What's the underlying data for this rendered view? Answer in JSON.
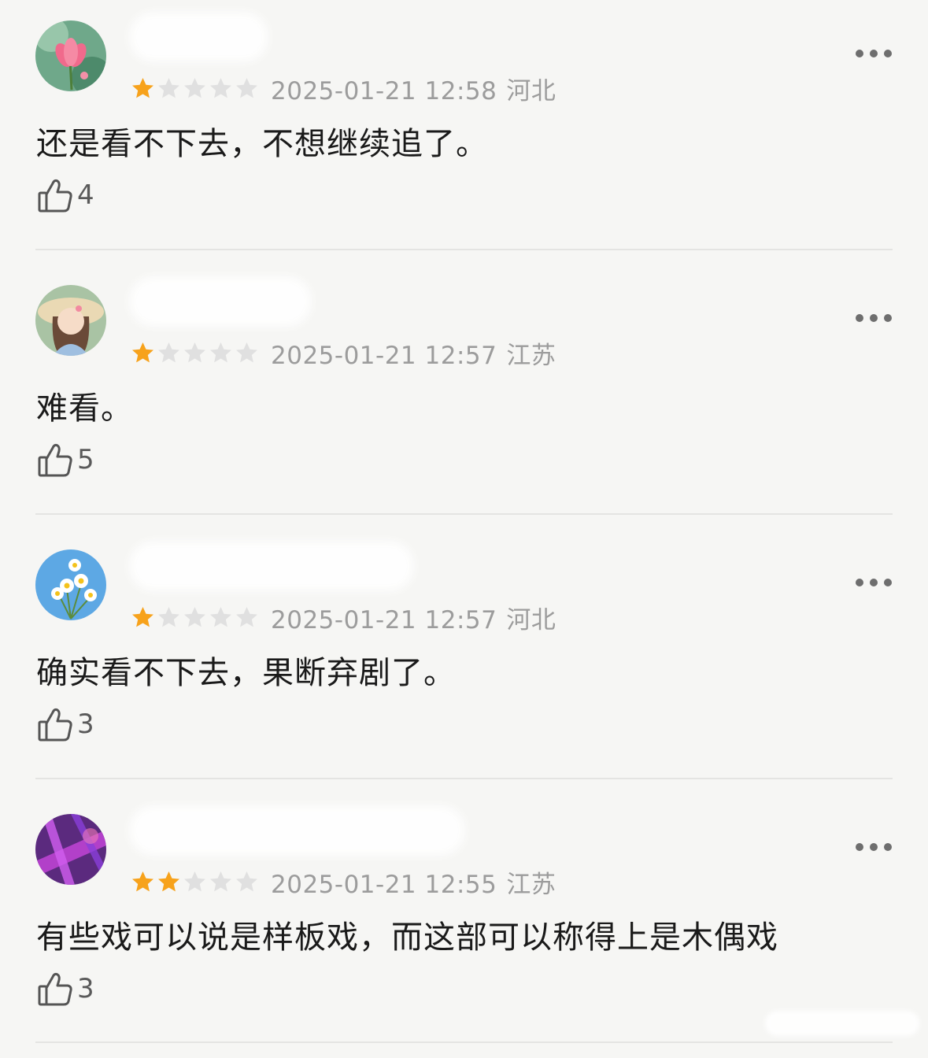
{
  "reviews": [
    {
      "avatar_icon": "lotus-flower-avatar-icon",
      "rating": 1,
      "rating_max": 5,
      "timestamp": "2025-01-21 12:58",
      "location": "河北",
      "comment": "还是看不下去，不想继续追了。",
      "likes": "4"
    },
    {
      "avatar_icon": "girl-with-hat-avatar-icon",
      "rating": 1,
      "rating_max": 5,
      "timestamp": "2025-01-21 12:57",
      "location": "江苏",
      "comment": "难看。",
      "likes": "5"
    },
    {
      "avatar_icon": "daisies-avatar-icon",
      "rating": 1,
      "rating_max": 5,
      "timestamp": "2025-01-21 12:57",
      "location": "河北",
      "comment": "确实看不下去，果断弃剧了。",
      "likes": "3"
    },
    {
      "avatar_icon": "purple-abstract-avatar-icon",
      "rating": 2,
      "rating_max": 5,
      "timestamp": "2025-01-21 12:55",
      "location": "江苏",
      "comment": "有些戏可以说是样板戏，而这部可以称得上是木偶戏",
      "likes": "3"
    }
  ],
  "colors": {
    "background": "#f6f6f4",
    "star_filled": "#f7a21b",
    "star_empty": "#e0e0e0",
    "meta_text": "#9c9c9c",
    "divider": "#e4e4e2"
  }
}
